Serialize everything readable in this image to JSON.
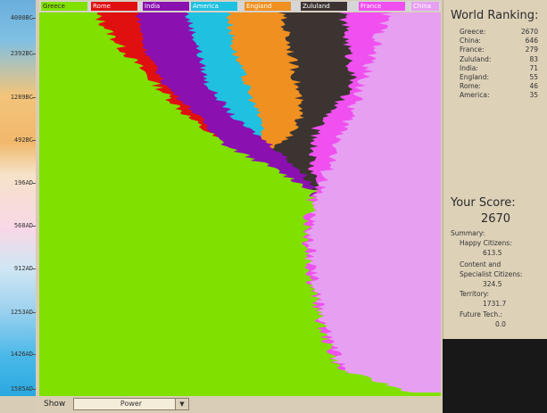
{
  "chart_data": {
    "type": "area",
    "title": "",
    "xlabel": "",
    "ylabel": "",
    "y_ticks": [
      "4000BC",
      "2392BC",
      "1289BC",
      "492BC",
      "196AD",
      "568AD",
      "912AD",
      "1253AD",
      "1426AD",
      "1585AD"
    ],
    "series": [
      {
        "name": "Greece",
        "color": "#80e000"
      },
      {
        "name": "Rome",
        "color": "#e01010"
      },
      {
        "name": "India",
        "color": "#8a10b0"
      },
      {
        "name": "America",
        "color": "#20c0e0"
      },
      {
        "name": "England",
        "color": "#f09020"
      },
      {
        "name": "Zululand",
        "color": "#3c3430"
      },
      {
        "name": "France",
        "color": "#f050f0"
      },
      {
        "name": "China",
        "color": "#e79ff2"
      }
    ]
  },
  "ranking": {
    "title": "World Ranking:",
    "rows": [
      {
        "name": "Greece:",
        "value": "2670"
      },
      {
        "name": "China:",
        "value": "646"
      },
      {
        "name": "France:",
        "value": "279"
      },
      {
        "name": "Zululand:",
        "value": "83"
      },
      {
        "name": "India:",
        "value": "71"
      },
      {
        "name": "England:",
        "value": "55"
      },
      {
        "name": "Rome:",
        "value": "46"
      },
      {
        "name": "America:",
        "value": "35"
      }
    ]
  },
  "score": {
    "title": "Your Score:",
    "value": "2670",
    "summary_label": "Summary:",
    "happy_label": "Happy Citizens:",
    "happy_value": "613.5",
    "content_label_1": "Content and",
    "content_label_2": "Specialist Citizens:",
    "content_value": "324.5",
    "territory_label": "Territory:",
    "territory_value": "1731.7",
    "future_label": "Future Tech.:",
    "future_value": "0.0"
  },
  "show": {
    "label": "Show",
    "selected": "Power"
  }
}
